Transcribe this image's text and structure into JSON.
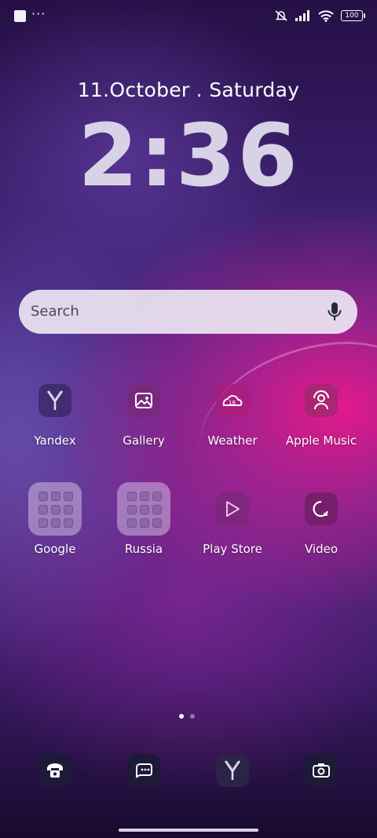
{
  "status_bar": {
    "notification_icon": "square-icon",
    "more_dots": "···",
    "icons": [
      "mute-icon",
      "signal-icon",
      "wifi-icon"
    ],
    "battery": "100"
  },
  "lockscreen": {
    "date": "11.October . Saturday",
    "time": "2:36"
  },
  "search": {
    "label": "Search",
    "icon": "mic-icon"
  },
  "apps_row1": [
    {
      "label": "Yandex",
      "icon": "yandex-icon"
    },
    {
      "label": "Gallery",
      "icon": "gallery-icon"
    },
    {
      "label": "Weather",
      "icon": "weather-icon"
    },
    {
      "label": "Apple Music",
      "icon": "apple-music-icon"
    }
  ],
  "apps_row2": [
    {
      "label": "Google",
      "icon": "folder-icon"
    },
    {
      "label": "Russia",
      "icon": "folder-icon"
    },
    {
      "label": "Play Store",
      "icon": "play-store-icon"
    },
    {
      "label": "Video",
      "icon": "video-icon"
    }
  ],
  "pager": {
    "pages": 2,
    "current": 1
  },
  "dock": [
    "phone-icon",
    "messages-icon",
    "yandex-browser-icon",
    "camera-icon"
  ],
  "colors": {
    "accent": "#ec188c",
    "background_top": "#261046",
    "search_bg": "#ebe4f2"
  }
}
